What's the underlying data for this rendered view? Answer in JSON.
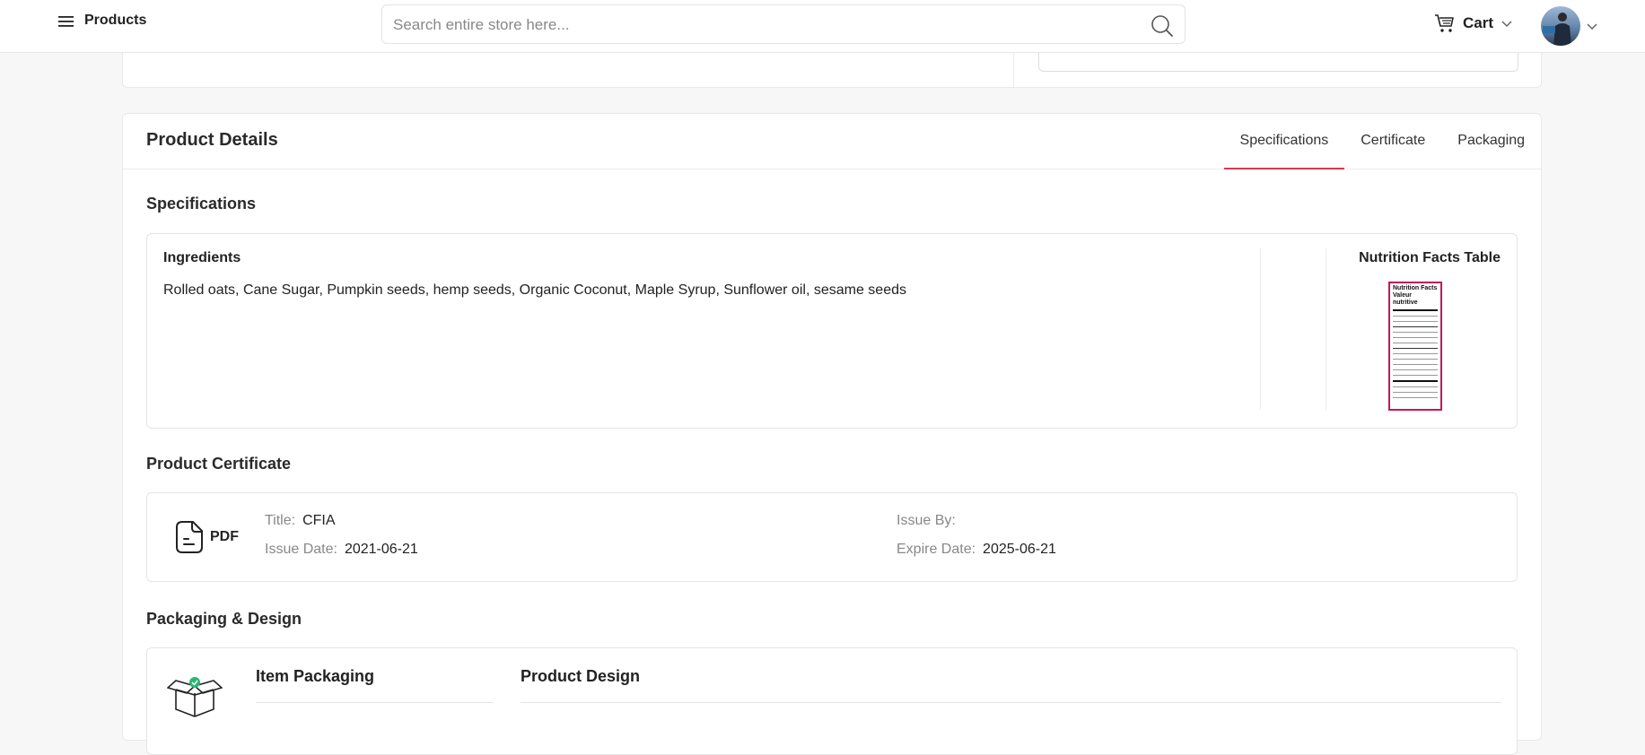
{
  "header": {
    "menu_label": "Products",
    "search_placeholder": "Search entire store here...",
    "cart_label": "Cart"
  },
  "product_details": {
    "title": "Product Details",
    "tabs": [
      {
        "label": "Specifications",
        "active": true
      },
      {
        "label": "Certificate",
        "active": false
      },
      {
        "label": "Packaging",
        "active": false
      }
    ]
  },
  "specifications": {
    "title": "Specifications",
    "ingredients_label": "Ingredients",
    "ingredients_text": "Rolled oats, Cane Sugar, Pumpkin seeds, hemp seeds, Organic Coconut, Maple Syrup, Sunflower oil, sesame seeds",
    "nutrition_label": "Nutrition Facts Table",
    "nutrition_image_text": [
      "Nutrition Facts",
      "Valeur nutritive"
    ]
  },
  "certificate": {
    "title": "Product Certificate",
    "file_type": "PDF",
    "title_key": "Title:",
    "title_value": "CFIA",
    "issue_date_key": "Issue Date:",
    "issue_date_value": "2021-06-21",
    "issue_by_key": "Issue By:",
    "issue_by_value": "",
    "expire_date_key": "Expire Date:",
    "expire_date_value": "2025-06-21"
  },
  "packaging": {
    "title": "Packaging & Design",
    "item_packaging_label": "Item Packaging",
    "product_design_label": "Product Design"
  },
  "colors": {
    "accent": "#d63a4f",
    "nutrition_border": "#c2185b",
    "box_icon_badge": "#2bb673"
  },
  "icons": {
    "menu": "hamburger-icon",
    "search": "search-icon",
    "cart": "cart-icon",
    "dropdown": "chevron-down-icon",
    "pdf": "document-icon",
    "packaging": "open-box-icon"
  }
}
